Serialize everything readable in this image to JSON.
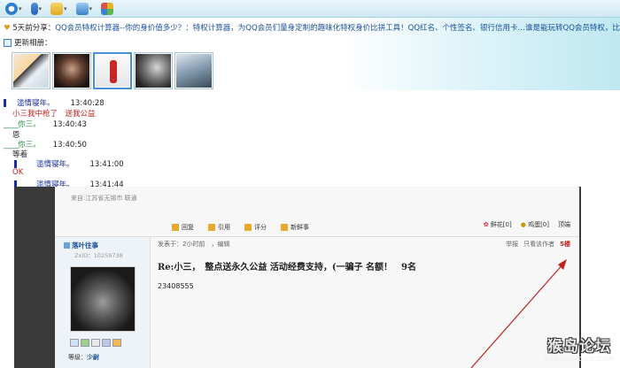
{
  "toolbar": {
    "icons": [
      "emoji-icon",
      "microphone-icon",
      "folder-icon",
      "screen-icon",
      "apps-icon"
    ]
  },
  "share": {
    "label": "5天前分享：",
    "text": "QQ会员特权计算器--你的身价值多少？：特权计算器，为QQ会员们量身定制的趣味化特权身价比拼工具！QQ红名、个性签名、银行信用卡…谁是能玩转QQ会员特权，比一比，就知"
  },
  "album": {
    "title": "更新相册："
  },
  "chat": {
    "m1_name": "滥情寝年。",
    "m1_time": "13:40:28",
    "m1_text": "小三我中枪了　送我公益",
    "m2_name": "你三。",
    "m2_time": "13:40:43",
    "m2_text": "恩",
    "m3_name": "你三。",
    "m3_time": "13:40:50",
    "m3_text": "等着",
    "m4_name": "滥情寝年。",
    "m4_time": "13:41:00",
    "m4_text": "OK",
    "m5_name": "滥情寝年。",
    "m5_time": "13:41:44"
  },
  "forum": {
    "from": "来自:江苏省无锡市 联通",
    "actions": [
      "回复",
      "引用",
      "评分",
      "新鲜事"
    ],
    "flower": "鲜花[0]",
    "egg": "鸡蛋[0]",
    "top": "顶端",
    "username": "落叶往事",
    "uid": "ZxID：10259738",
    "level_label": "等级：",
    "level_value": "少尉",
    "posted": "发表于：2小时前　，编辑",
    "report": "举报",
    "only_author": "只看该作者",
    "floor": "5楼",
    "title": "Re:小三，　整点送永久公益 活动经费支持，(一骗子 名额！　9名",
    "body": "23408555"
  },
  "watermark": {
    "big": "猴岛论坛",
    "small": "BBS.HOUDAO.COM"
  },
  "colors": {
    "toolbar_bg": "#cfe8f3",
    "link_blue": "#1b4f9c",
    "name_blue": "#1b2f9a",
    "name_green": "#2d8a4d",
    "msg_red": "#c0221e"
  }
}
